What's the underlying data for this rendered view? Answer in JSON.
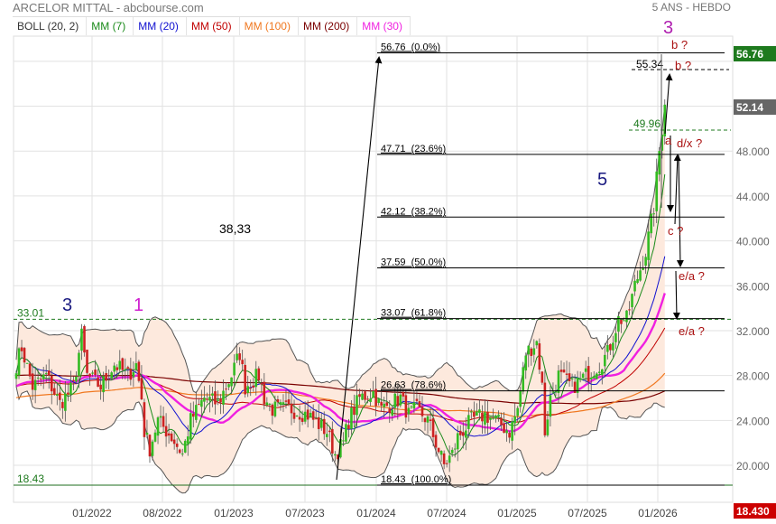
{
  "header": {
    "title": "ARCELOR MITTAL - abcbourse.com",
    "period": "5 ANS - HEBDO"
  },
  "legend": [
    {
      "label": "BOLL (20, 2)",
      "color": "#333333"
    },
    {
      "label": "MM (7)",
      "color": "#1a8a1a"
    },
    {
      "label": "MM (20)",
      "color": "#1010d0"
    },
    {
      "label": "MM (50)",
      "color": "#c00000"
    },
    {
      "label": "MM (100)",
      "color": "#f07820"
    },
    {
      "label": "MM (200)",
      "color": "#7a0000"
    },
    {
      "label": "MM (30)",
      "color": "#f020e0"
    }
  ],
  "chart_data": {
    "type": "candlestick",
    "title": "ARCELOR MITTAL",
    "x_unit": "weeks since 2021-06",
    "xticks": [
      "01/2022",
      "08/2022",
      "01/2023",
      "07/2023",
      "01/2024",
      "07/2024",
      "01/2025",
      "07/2025",
      "01/2026"
    ],
    "yticks": [
      "20.000",
      "24.000",
      "28.000",
      "32.000",
      "36.000",
      "40.000",
      "44.000",
      "48.000"
    ],
    "ylim": [
      17,
      58
    ],
    "close_keypoints": [
      [
        0,
        29
      ],
      [
        2,
        30.5
      ],
      [
        6,
        27
      ],
      [
        11,
        28
      ],
      [
        16,
        25.5
      ],
      [
        21,
        27
      ],
      [
        24,
        31.5
      ],
      [
        26,
        28
      ],
      [
        31,
        27
      ],
      [
        36,
        29
      ],
      [
        41,
        28
      ],
      [
        44,
        29
      ],
      [
        46,
        26
      ],
      [
        47,
        23
      ],
      [
        49,
        21.5
      ],
      [
        52,
        24
      ],
      [
        57,
        22.5
      ],
      [
        61,
        21
      ],
      [
        64,
        24
      ],
      [
        69,
        26
      ],
      [
        74,
        25.5
      ],
      [
        79,
        28
      ],
      [
        82,
        30
      ],
      [
        84,
        27
      ],
      [
        89,
        28
      ],
      [
        91,
        26
      ],
      [
        94,
        25
      ],
      [
        101,
        25
      ],
      [
        107,
        24.5
      ],
      [
        114,
        23
      ],
      [
        117,
        21
      ],
      [
        120,
        22
      ],
      [
        122,
        24
      ],
      [
        126,
        26
      ],
      [
        131,
        26.5
      ],
      [
        134,
        25
      ],
      [
        141,
        26
      ],
      [
        144,
        24.5
      ],
      [
        147,
        25
      ],
      [
        151,
        24
      ],
      [
        154,
        22
      ],
      [
        157,
        20
      ],
      [
        160,
        21
      ],
      [
        162,
        22.5
      ],
      [
        167,
        24
      ],
      [
        172,
        24.5
      ],
      [
        176,
        24
      ],
      [
        181,
        23
      ],
      [
        184,
        25
      ],
      [
        187,
        30
      ],
      [
        191,
        31
      ],
      [
        193,
        27
      ],
      [
        194,
        23
      ],
      [
        196,
        26
      ],
      [
        199,
        28
      ],
      [
        204,
        27
      ],
      [
        209,
        28
      ],
      [
        214,
        29
      ],
      [
        217,
        30
      ],
      [
        221,
        33
      ],
      [
        224,
        33
      ],
      [
        227,
        36
      ],
      [
        231,
        39
      ],
      [
        234,
        43
      ],
      [
        236,
        48
      ],
      [
        238,
        52.14
      ]
    ],
    "last_price": "52.14",
    "price_tags": [
      {
        "label": "56.76",
        "color": "#1e7a1e"
      },
      {
        "label": "52.14",
        "color": "#666666"
      },
      {
        "label": "18.430",
        "color": "#cc0000"
      }
    ],
    "fibonacci": [
      {
        "price": 56.76,
        "label": "56.76  (0.0%)"
      },
      {
        "price": 47.71,
        "label": "47.71  (23.6%)"
      },
      {
        "price": 42.12,
        "label": "42.12  (38.2%)"
      },
      {
        "price": 37.59,
        "label": "37.59  (50.0%)"
      },
      {
        "price": 33.07,
        "label": "33.07  (61.8%)"
      },
      {
        "price": 26.63,
        "label": "26.63  (78.6%)"
      },
      {
        "price": 18.43,
        "label": "18.43  (100.0%)"
      }
    ],
    "levels": [
      {
        "price": 33.01,
        "label": "33.01"
      },
      {
        "price": 18.43,
        "label": "18.43"
      },
      {
        "price": 49.96,
        "label": "49.96"
      },
      {
        "price": 55.34,
        "label": "55.34"
      }
    ],
    "annotations": {
      "wave3_left": "3",
      "wave1": "1",
      "note": "38,33",
      "wave5": "5",
      "wave3_top": "3",
      "b1": "b ?",
      "b2": "b ?",
      "a": "a",
      "dx": "d/x ?",
      "c": "c ?",
      "ea1": "e/a ?",
      "ea2": "e/a ?"
    }
  }
}
